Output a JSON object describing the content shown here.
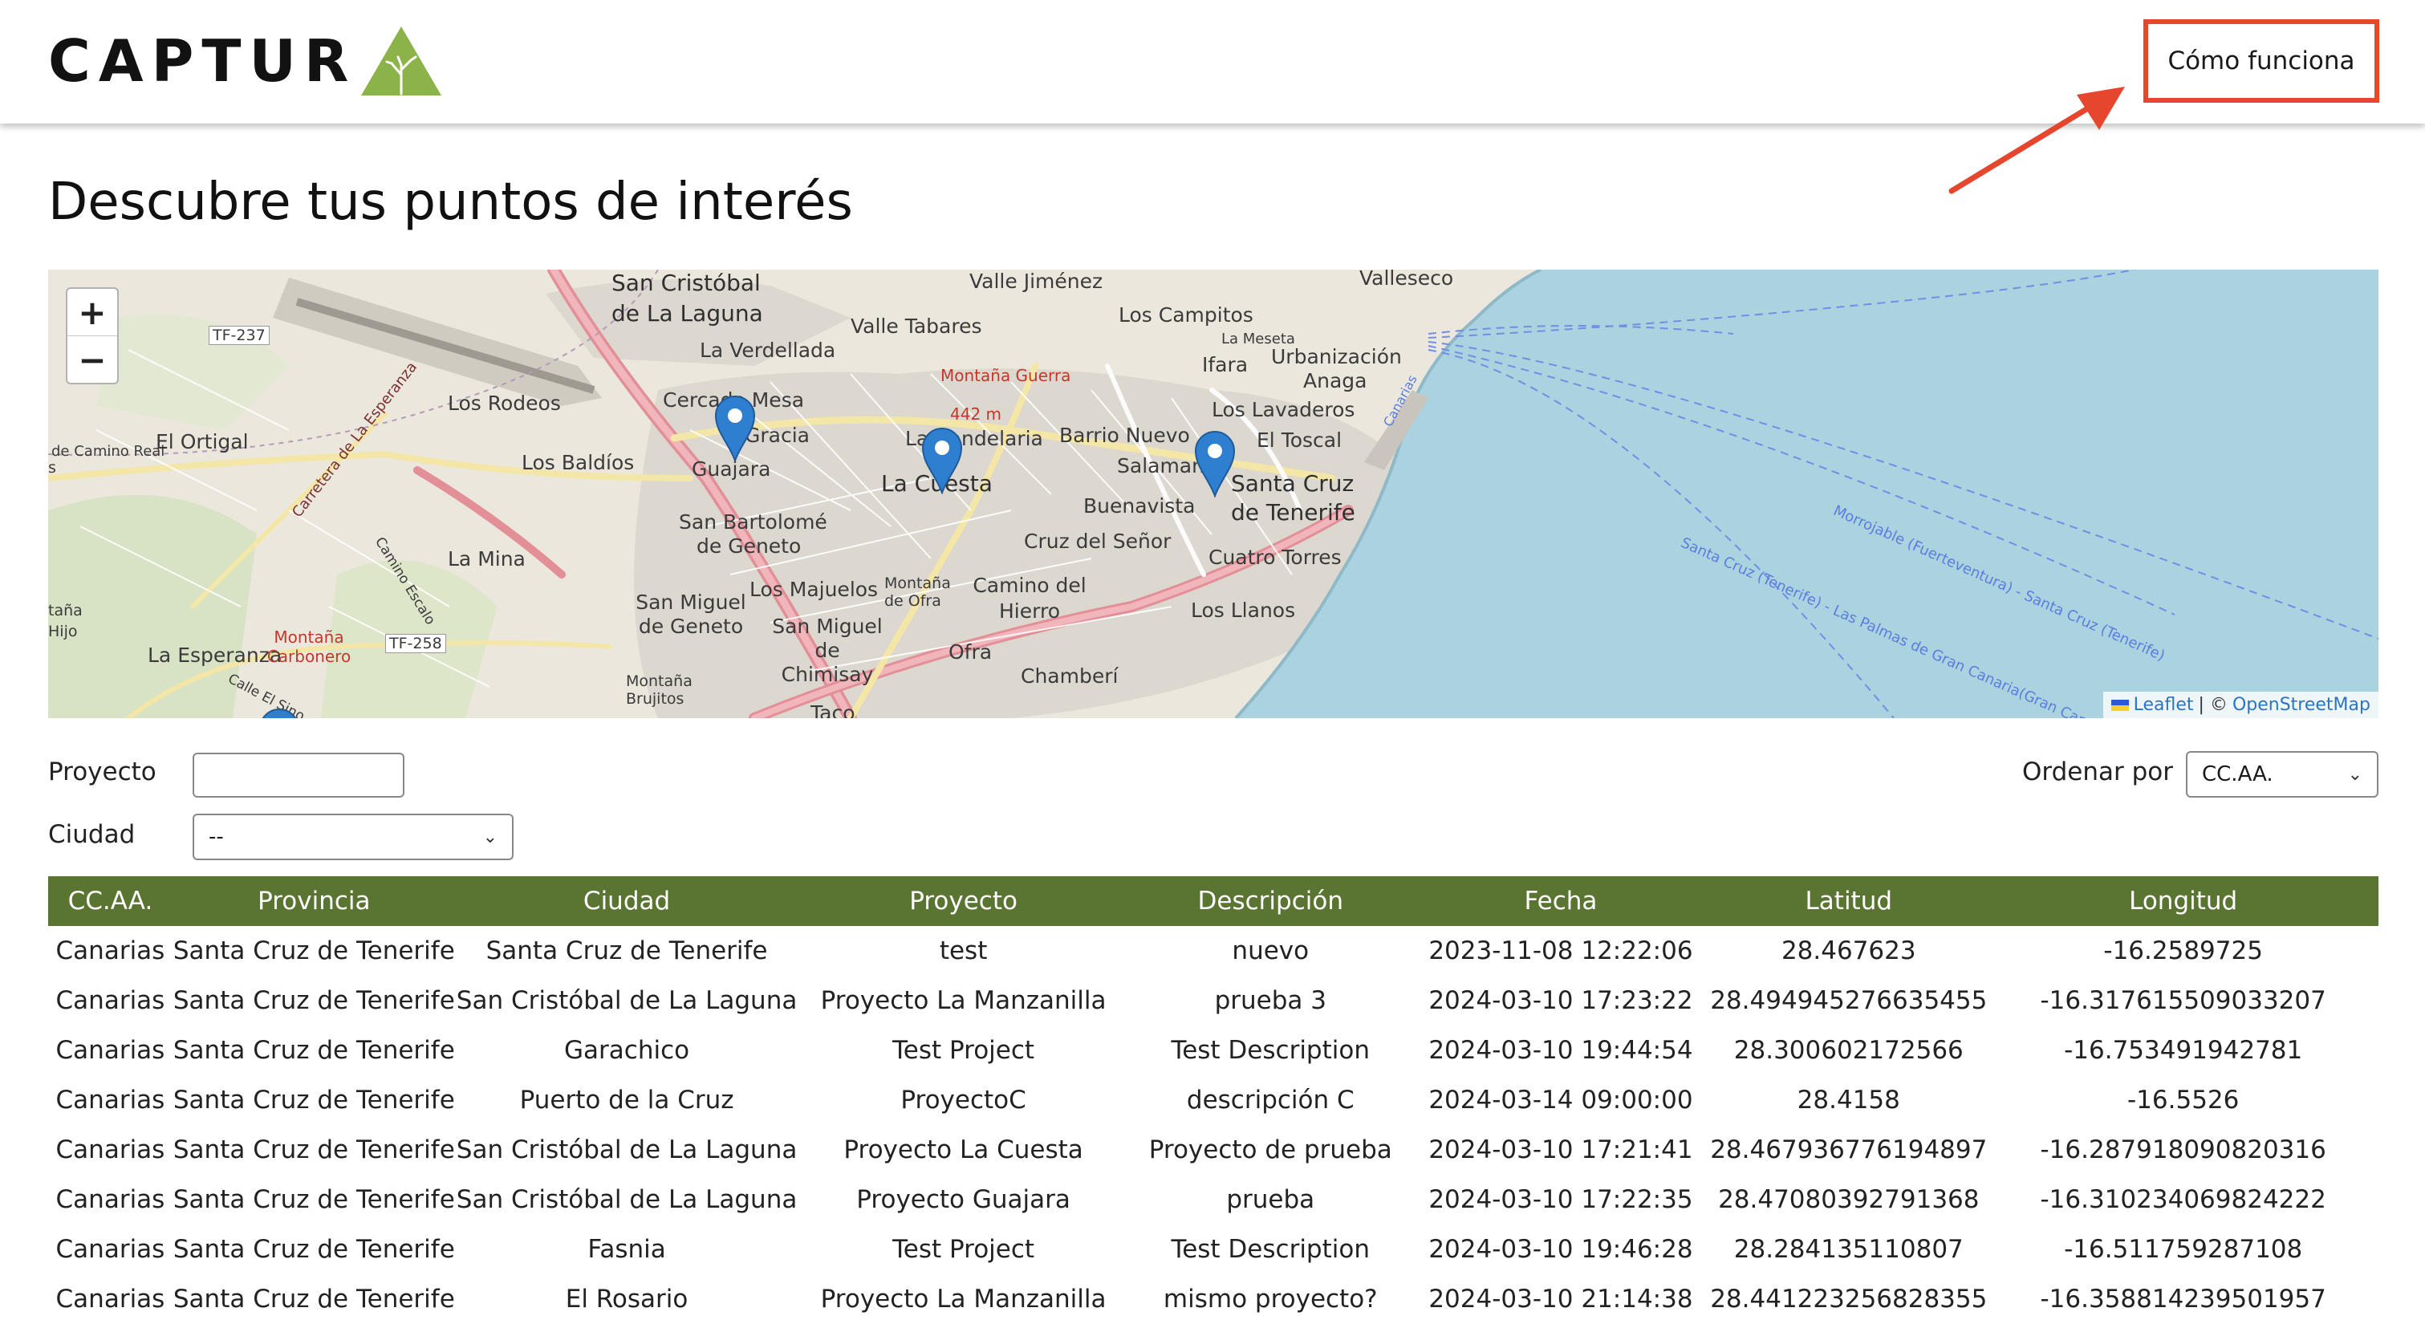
{
  "header": {
    "logo_text": "CAPTUR",
    "how_it_works_label": "Cómo funciona"
  },
  "colors": {
    "brand_green": "#5a7431",
    "logo_triangle": "#8cb24a",
    "annotation_red": "#e5462d"
  },
  "page_title": "Descubre tus puntos de interés",
  "map": {
    "zoom_in": "+",
    "zoom_out": "−",
    "attribution_leaflet": "Leaflet",
    "attribution_sep": "| ©",
    "attribution_osm": "OpenStreetMap",
    "labels": {
      "san_cristobal": "San Cristóbal",
      "de_la_laguna": "de La Laguna",
      "valle_jimenez": "Valle Jiménez",
      "valleseco": "Valleseco",
      "los_campitos": "Los Campitos",
      "valle_tabares": "Valle Tabares",
      "la_meseta": "La Meseta",
      "urbanizacion": "Urbanización",
      "anaga": "Anaga",
      "ifara": "Ifara",
      "la_verdellada": "La Verdellada",
      "montana_guerra": "Montaña Guerra",
      "alt_442": "442 m",
      "los_rodeos": "Los Rodeos",
      "cercado_mesa": "Cercado Mesa",
      "gracia": "Gracia",
      "la_candelaria": "La Candelaria",
      "barrio_nuevo": "Barrio Nuevo",
      "los_lavaderos": "Los Lavaderos",
      "el_ortigal": "El Ortigal",
      "camino_real": "de Camino Real",
      "los_baldios": "Los Baldíos",
      "guajara": "Guajara",
      "la_cuesta": "La Cuesta",
      "salamanca": "Salamanca",
      "el_toscal": "El Toscal",
      "santa_cruz": "Santa Cruz",
      "de_tenerife": "de Tenerife",
      "buenavista": "Buenavista",
      "san_bartolome": "San Bartolomé",
      "de_geneto": "de Geneto",
      "cruz_del_senor": "Cruz del Señor",
      "cuatro_torres": "Cuatro Torres",
      "la_mina": "La Mina",
      "los_majuelos": "Los Majuelos",
      "montana_ofra": "Montaña de Ofra",
      "camino_del_hierro": "Camino del Hierro",
      "los_llanos": "Los Llanos",
      "san_miguel_geneto": "San Miguel de Geneto",
      "san_miguel_chimisay": "San Miguel de Chimisay",
      "ofra": "Ofra",
      "chamberi": "Chamberí",
      "la_esperanza": "La Esperanza",
      "montana_carbonero": "Montaña Carbonero",
      "montana_brujitos": "Montaña Brujitos",
      "taco": "Taco",
      "tf237": "TF-237",
      "tf258": "TF-258",
      "ferry1": "Santa Cruz (Tenerife) - Las Palmas de Gran Canaria(Gran Canaria)",
      "ferry2": "Morrojable (Fuerteventura) - Santa Cruz (Tenerife)",
      "canarias": "Canarias",
      "carretera": "Carretera de La Esperanza",
      "camino_escalo": "Camino Escalo",
      "calle_sino": "Calle El Sino",
      "hijo": "Hijo",
      "tana": "taña",
      "el_s": "s"
    }
  },
  "filters": {
    "project_label": "Proyecto",
    "project_value": "",
    "city_label": "Ciudad",
    "city_selected": "--",
    "sort_label": "Ordenar por",
    "sort_selected": "CC.AA."
  },
  "table": {
    "headers": [
      "CC.AA.",
      "Provincia",
      "Ciudad",
      "Proyecto",
      "Descripción",
      "Fecha",
      "Latitud",
      "Longitud"
    ],
    "rows": [
      [
        "Canarias",
        "Santa Cruz de Tenerife",
        "Santa Cruz de Tenerife",
        "test",
        "nuevo",
        "2023-11-08 12:22:06",
        "28.467623",
        "-16.2589725"
      ],
      [
        "Canarias",
        "Santa Cruz de Tenerife",
        "San Cristóbal de La Laguna",
        "Proyecto La Manzanilla",
        "prueba 3",
        "2024-03-10 17:23:22",
        "28.494945276635455",
        "-16.317615509033207"
      ],
      [
        "Canarias",
        "Santa Cruz de Tenerife",
        "Garachico",
        "Test Project",
        "Test Description",
        "2024-03-10 19:44:54",
        "28.300602172566",
        "-16.753491942781"
      ],
      [
        "Canarias",
        "Santa Cruz de Tenerife",
        "Puerto de la Cruz",
        "ProyectoC",
        "descripción C",
        "2024-03-14 09:00:00",
        "28.4158",
        "-16.5526"
      ],
      [
        "Canarias",
        "Santa Cruz de Tenerife",
        "San Cristóbal de La Laguna",
        "Proyecto La Cuesta",
        "Proyecto de prueba",
        "2024-03-10 17:21:41",
        "28.467936776194897",
        "-16.287918090820316"
      ],
      [
        "Canarias",
        "Santa Cruz de Tenerife",
        "San Cristóbal de La Laguna",
        "Proyecto Guajara",
        "prueba",
        "2024-03-10 17:22:35",
        "28.47080392791368",
        "-16.310234069824222"
      ],
      [
        "Canarias",
        "Santa Cruz de Tenerife",
        "Fasnia",
        "Test Project",
        "Test Description",
        "2024-03-10 19:46:28",
        "28.284135110807",
        "-16.511759287108"
      ],
      [
        "Canarias",
        "Santa Cruz de Tenerife",
        "El Rosario",
        "Proyecto La Manzanilla",
        "mismo proyecto?",
        "2024-03-10 21:14:38",
        "28.441223256828355",
        "-16.358814239501957"
      ]
    ]
  }
}
